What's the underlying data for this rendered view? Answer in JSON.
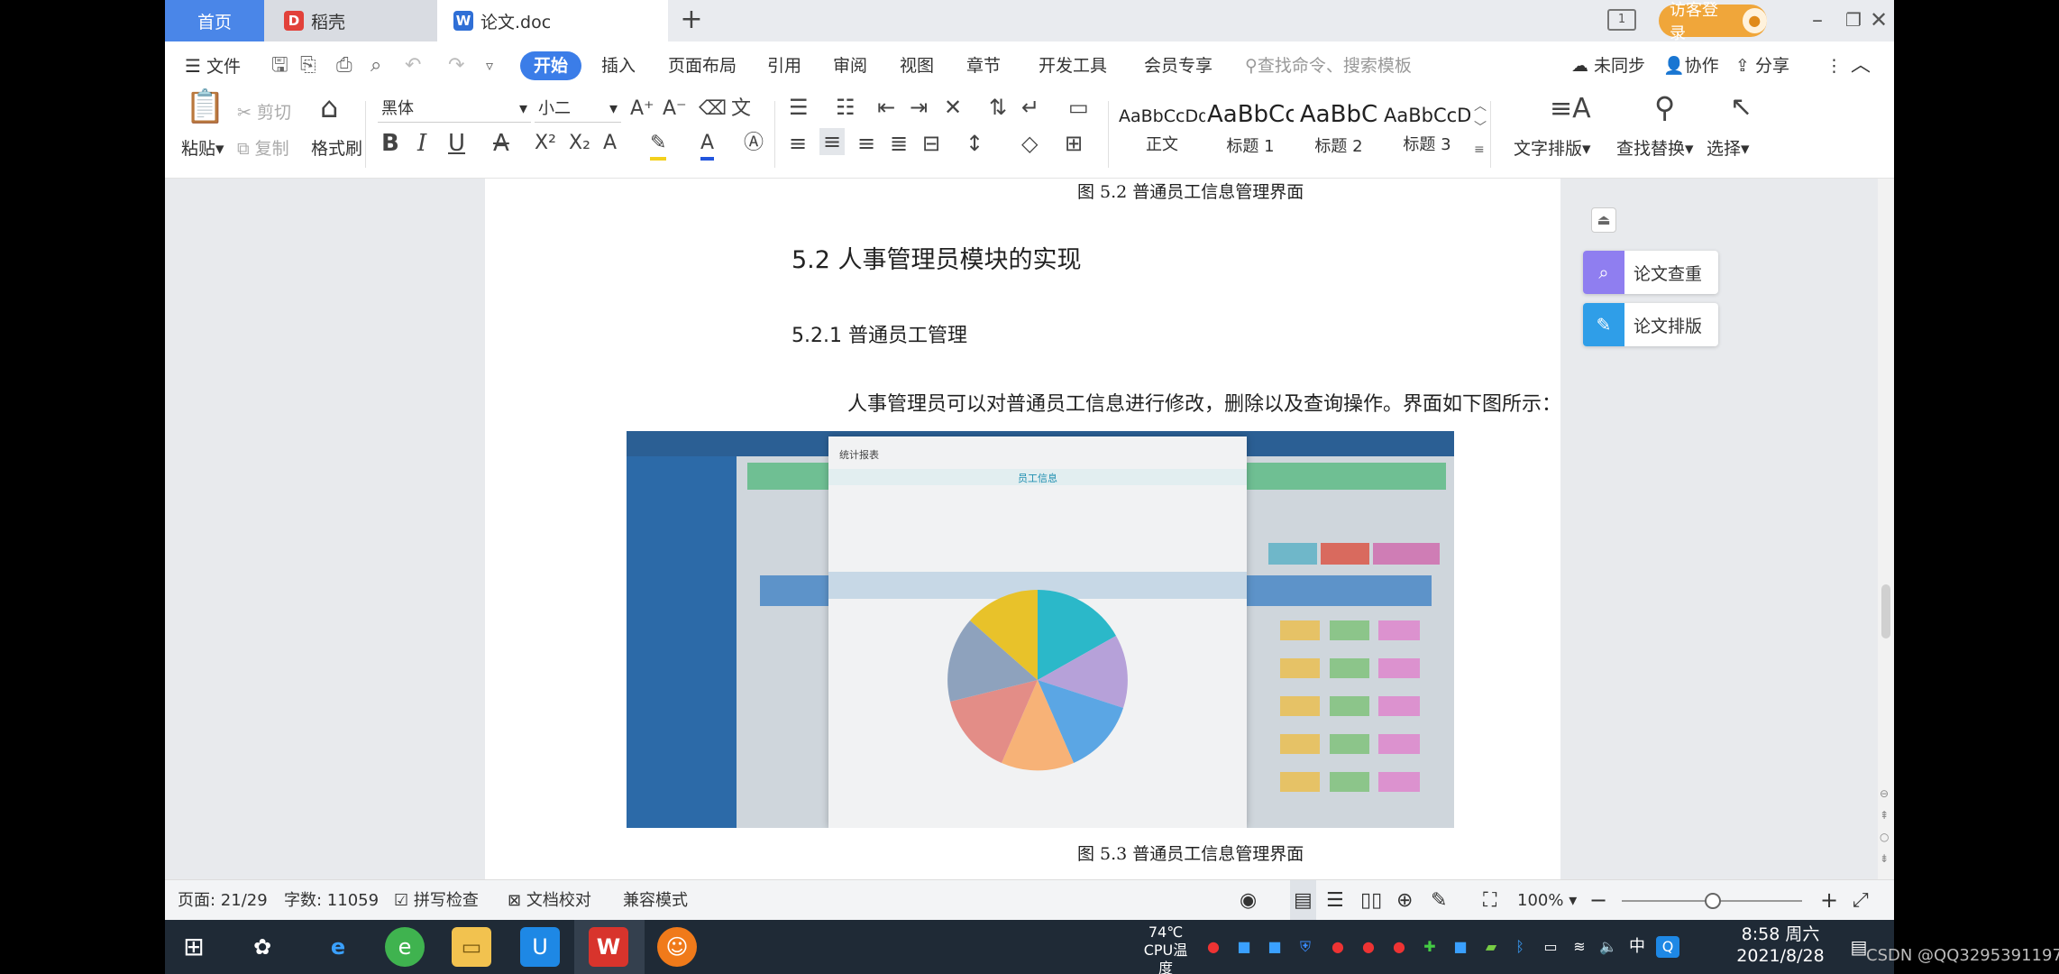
{
  "titlebar": {
    "tabs": [
      {
        "label": "首页"
      },
      {
        "label": "稻壳"
      },
      {
        "label": "论文.doc"
      }
    ],
    "new_tab": "+",
    "login": "访客登录"
  },
  "menubar": {
    "items": [
      "文件",
      "开始",
      "插入",
      "页面布局",
      "引用",
      "审阅",
      "视图",
      "章节",
      "开发工具",
      "会员专享"
    ],
    "search_placeholder": "查找命令、搜索模板",
    "unsynced": "未同步",
    "collaborate": "协作",
    "share": "分享"
  },
  "ribbon": {
    "paste": "粘贴",
    "cut": "剪切",
    "copy": "复制",
    "format_painter": "格式刷",
    "font_name": "黑体",
    "font_size": "小二",
    "styles": [
      {
        "preview": "AaBbCcDd",
        "label": "正文"
      },
      {
        "preview": "AaBbCc",
        "label": "标题 1"
      },
      {
        "preview": "AaBbC",
        "label": "标题 2"
      },
      {
        "preview": "AaBbCcD",
        "label": "标题 3"
      }
    ],
    "text_layout": "文字排版",
    "find_replace": "查找替换",
    "select": "选择"
  },
  "document": {
    "caption_top": "图 5.2  普通员工信息管理界面",
    "heading2": "5.2  人事管理员模块的实现",
    "heading3": "5.2.1  普通员工管理",
    "paragraph": "人事管理员可以对普通员工信息进行修改，删除以及查询操作。界面如下图所示：",
    "caption_bottom": "图 5.3  普通员工信息管理界面",
    "embedded": {
      "modal_title": "统计报表",
      "chart_title": "员工信息"
    }
  },
  "right_panel": {
    "check": "论文查重",
    "format": "论文排版"
  },
  "statusbar": {
    "page": "页面: 21/29",
    "words": "字数: 11059",
    "spell": "拼写检查",
    "proof": "文档校对",
    "compat": "兼容模式",
    "zoom": "100%"
  },
  "taskbar": {
    "temp": "74℃",
    "cpu": "CPU温度",
    "ime": "中",
    "time": "8:58 周六",
    "date": "2021/8/28"
  },
  "watermark": "CSDN @QQ3295391197",
  "colors": {
    "accent": "#3b7de8",
    "login": "#f0a63a",
    "taskbar": "#1f2a36"
  }
}
